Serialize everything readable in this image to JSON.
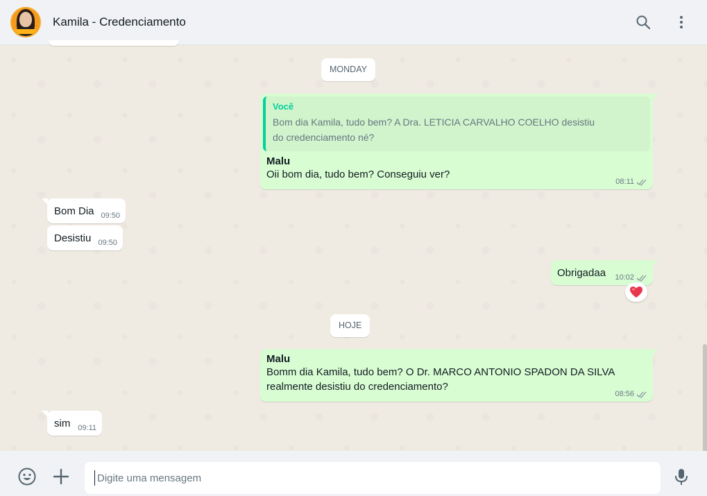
{
  "header": {
    "contact_name": "Kamila - Credenciamento",
    "avatar_icon": "contact-avatar",
    "search_icon": "search-icon",
    "menu_icon": "more-vertical-icon"
  },
  "chat": {
    "day_dividers": [
      "MONDAY",
      "HOJE"
    ],
    "messages": [
      {
        "direction": "out",
        "quote_author": "Você",
        "quote_text": "Bom dia Kamila, tudo bem? A Dra. LETICIA CARVALHO COELHO desistiu do credenciamento né?",
        "sender": "Malu",
        "text": "Oii bom dia, tudo bem? Conseguiu ver?",
        "time": "08:11",
        "status": "read"
      },
      {
        "direction": "in",
        "text": "Bom Dia",
        "time": "09:50"
      },
      {
        "direction": "in",
        "text": "Desistiu",
        "time": "09:50"
      },
      {
        "direction": "out",
        "text": "Obrigadaa",
        "time": "10:02",
        "status": "read",
        "reaction": "❤️"
      },
      {
        "direction": "out",
        "sender": "Malu",
        "text": "Bomm dia Kamila, tudo bem? O Dr. MARCO ANTONIO SPADON DA SILVA realmente desistiu do credenciamento?",
        "time": "08:56",
        "status": "read"
      },
      {
        "direction": "in",
        "text": "sim",
        "time": "09:11"
      }
    ]
  },
  "composer": {
    "placeholder": "Digite uma mensagem",
    "value": ""
  },
  "colors": {
    "outgoing_bubble": "#d9fdd3",
    "incoming_bubble": "#ffffff",
    "chat_background": "#efeae2",
    "quote_accent": "#06cf9c",
    "read_ticks": "#8696a0"
  }
}
